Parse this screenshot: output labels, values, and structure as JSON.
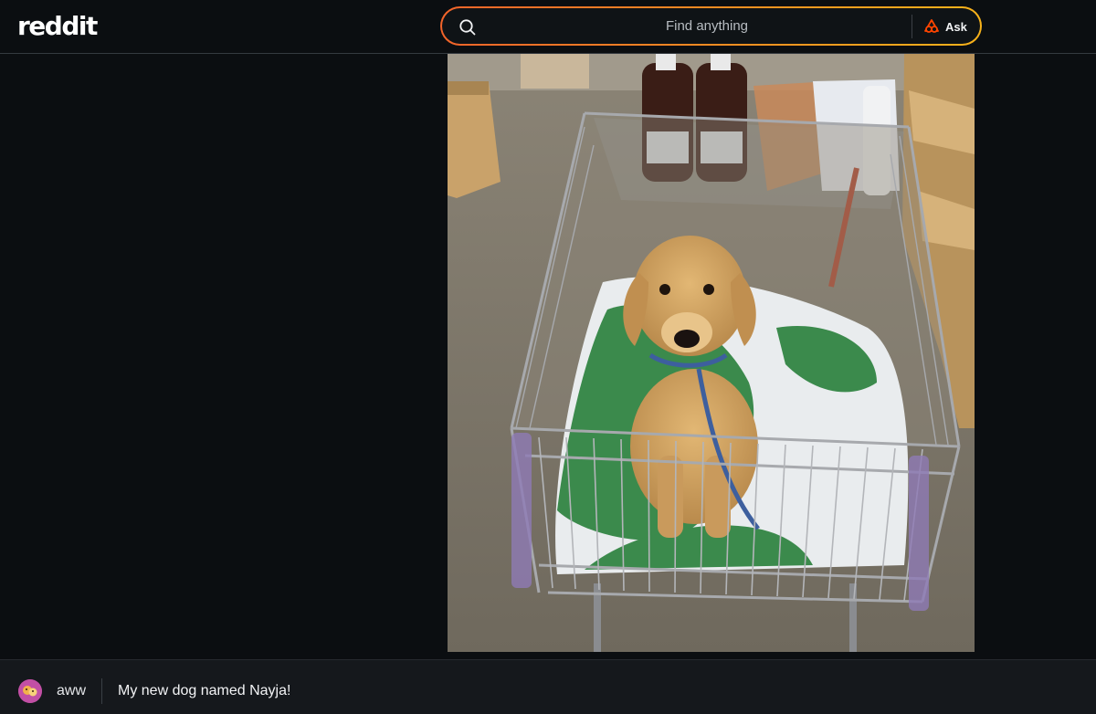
{
  "header": {
    "logo_text": "reddit",
    "search": {
      "placeholder": "Find anything"
    },
    "ask_label": "Ask"
  },
  "post": {
    "image_alt": "Golden retriever puppy sitting on a towel in a shopping cart",
    "subreddit": "aww",
    "title": "My new dog named Nayja!"
  },
  "colors": {
    "background": "#0b0e11",
    "search_border_start": "#f2642a",
    "search_border_end": "#f7b21a",
    "ask_icon": "#ff4500"
  },
  "icons": {
    "search": "search-icon",
    "ask": "answers-icon",
    "avatar": "subreddit-avatar"
  }
}
